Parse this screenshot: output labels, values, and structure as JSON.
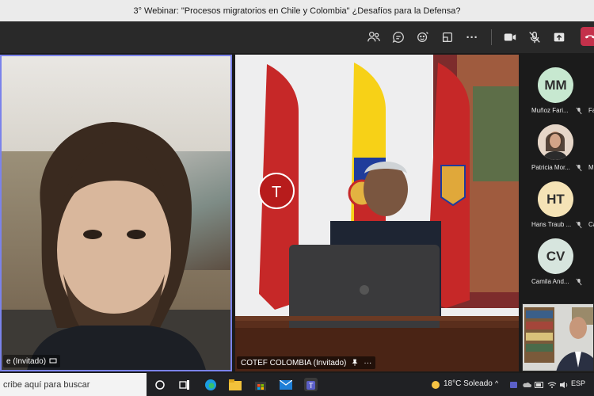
{
  "window": {
    "title": "3° Webinar: \"Procesos migratorios en Chile y Colombia\" ¿Desafíos para la Defensa?"
  },
  "toolbar": {
    "icons": [
      "people-icon",
      "chat-icon",
      "reactions-icon",
      "rooms-icon",
      "more-icon",
      "camera-icon",
      "mic-off-icon",
      "share-icon",
      "hangup-icon"
    ],
    "more_label": "···"
  },
  "tiles": [
    {
      "name_label": "e (Invitado)"
    },
    {
      "name_label": "COTEF COLOMBIA (Invitado)",
      "more_label": "···"
    }
  ],
  "participants": [
    {
      "initials": "MM",
      "name": "Muñoz Fari...",
      "next_label": "Fa",
      "avatar_color": "#c7e8d0",
      "muted": true
    },
    {
      "initials": "",
      "name": "Patricia Mor...",
      "next_label": "Mi",
      "avatar_color": "#d9c3b5",
      "muted": true
    },
    {
      "initials": "HT",
      "name": "Hans Traub ...",
      "next_label": "Ca",
      "avatar_color": "#f5e3b6",
      "muted": true
    },
    {
      "initials": "CV",
      "name": "Camila And...",
      "next_label": "",
      "avatar_color": "#d7e5de",
      "muted": true
    }
  ],
  "taskbar": {
    "search_placeholder": "cribe aquí para buscar",
    "weather": "18°C  Soleado",
    "language": "ESP"
  },
  "colors": {
    "accent": "#7b83eb",
    "hangup": "#c4314b",
    "toolbar_bg": "#292929"
  }
}
